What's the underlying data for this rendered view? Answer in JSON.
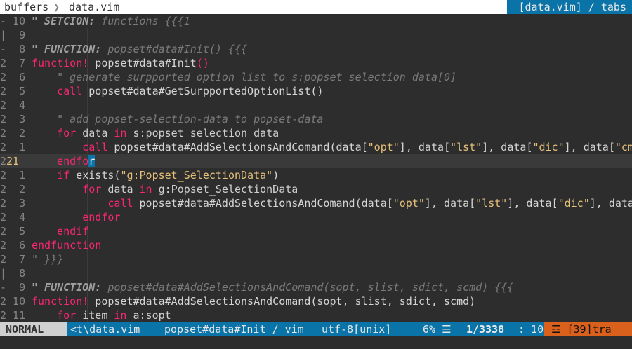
{
  "tabline": {
    "left_label": "buffers",
    "file_tab": "data.vim",
    "right_label": "[data.vim] / tabs"
  },
  "lines": [
    {
      "rel": "10",
      "abs_prefix": "-",
      "parts": [
        [
          "cmb",
          "\" SETCION:"
        ],
        [
          "cm",
          " functions {{{1"
        ]
      ]
    },
    {
      "rel": "9",
      "abs_prefix": "|",
      "parts": []
    },
    {
      "rel": "8",
      "abs_prefix": "-",
      "parts": [
        [
          "cmb",
          "\" FUNCTION:"
        ],
        [
          "cm",
          " popset#data#Init() {{{"
        ]
      ]
    },
    {
      "rel": "7",
      "abs_prefix": "2",
      "parts": [
        [
          "kw",
          "function!"
        ],
        [
          "fn",
          " popset#data#Init"
        ],
        [
          "kw",
          "()"
        ]
      ]
    },
    {
      "rel": "6",
      "abs_prefix": "2",
      "parts": [
        [
          "cm",
          "    \" generate surpported option list to s:popset_selection_data[0]"
        ]
      ]
    },
    {
      "rel": "5",
      "abs_prefix": "2",
      "parts": [
        [
          "kw",
          "    call"
        ],
        [
          "fn",
          " popset#data#GetSurpportedOptionList()"
        ]
      ]
    },
    {
      "rel": "4",
      "abs_prefix": "2",
      "parts": []
    },
    {
      "rel": "3",
      "abs_prefix": "2",
      "parts": [
        [
          "cm",
          "    \" add popset-selection-data to popset-data"
        ]
      ]
    },
    {
      "rel": "2",
      "abs_prefix": "2",
      "parts": [
        [
          "kw",
          "    for"
        ],
        [
          "var",
          " data"
        ],
        [
          "kw",
          " in"
        ],
        [
          "var",
          " s:popset_selection_data"
        ]
      ]
    },
    {
      "rel": "1",
      "abs_prefix": "2",
      "parts": [
        [
          "kw",
          "        call"
        ],
        [
          "fn",
          " popset#data#AddSelectionsAndComand(data["
        ],
        [
          "str",
          "\"opt\""
        ],
        [
          "fn",
          "], data["
        ],
        [
          "str",
          "\"lst\""
        ],
        [
          "fn",
          "], data["
        ],
        [
          "str",
          "\"dic\""
        ],
        [
          "fn",
          "], data["
        ],
        [
          "str",
          "\"cm"
        ]
      ]
    },
    {
      "rel": "21",
      "abs_prefix": "2",
      "current": true,
      "parts": [
        [
          "kw",
          "    endfo"
        ],
        [
          "cursor",
          "r"
        ]
      ]
    },
    {
      "rel": "1",
      "abs_prefix": "2",
      "parts": [
        [
          "kw",
          "    if"
        ],
        [
          "fn",
          " exists("
        ],
        [
          "str",
          "\"g:Popset_SelectionData\""
        ],
        [
          "fn",
          ")"
        ]
      ]
    },
    {
      "rel": "2",
      "abs_prefix": "2",
      "parts": [
        [
          "kw",
          "        for"
        ],
        [
          "var",
          " data"
        ],
        [
          "kw",
          " in"
        ],
        [
          "var",
          " g:Popset_SelectionData"
        ]
      ]
    },
    {
      "rel": "3",
      "abs_prefix": "2",
      "parts": [
        [
          "kw",
          "            call"
        ],
        [
          "fn",
          " popset#data#AddSelectionsAndComand(data["
        ],
        [
          "str",
          "\"opt\""
        ],
        [
          "fn",
          "], data["
        ],
        [
          "str",
          "\"lst\""
        ],
        [
          "fn",
          "], data["
        ],
        [
          "str",
          "\"dic\""
        ],
        [
          "fn",
          "], data"
        ]
      ]
    },
    {
      "rel": "4",
      "abs_prefix": "2",
      "parts": [
        [
          "kw",
          "        endfor"
        ]
      ]
    },
    {
      "rel": "5",
      "abs_prefix": "2",
      "parts": [
        [
          "kw",
          "    endif"
        ]
      ]
    },
    {
      "rel": "6",
      "abs_prefix": "2",
      "parts": [
        [
          "kw",
          "endfunction"
        ]
      ]
    },
    {
      "rel": "7",
      "abs_prefix": "2",
      "parts": [
        [
          "cm",
          "\" }}}"
        ]
      ]
    },
    {
      "rel": "8",
      "abs_prefix": "|",
      "parts": []
    },
    {
      "rel": "9",
      "abs_prefix": "-",
      "parts": [
        [
          "cmb",
          "\" FUNCTION:"
        ],
        [
          "cm",
          " popset#data#AddSelectionsAndComand(sopt, slist, sdict, scmd) {{{"
        ]
      ]
    },
    {
      "rel": "10",
      "abs_prefix": "2",
      "parts": [
        [
          "kw",
          "function!"
        ],
        [
          "fn",
          " popset#data#AddSelectionsAndComand(sopt, slist, sdict, scmd)"
        ]
      ]
    },
    {
      "rel": "11",
      "abs_prefix": "2",
      "parts": [
        [
          "kw",
          "    for"
        ],
        [
          "var",
          " item"
        ],
        [
          "kw",
          " in"
        ],
        [
          "var",
          " a:sopt"
        ]
      ]
    }
  ],
  "statusline": {
    "mode": "NORMAL",
    "file": "<t\\data.vim",
    "function": "popset#data#Init / vim",
    "encoding": "utf-8[unix]",
    "percent": "6% ☰",
    "position": "1/3338",
    "column": ": 10",
    "warning": "☲ [39]tra"
  },
  "colors": {
    "accent": "#0a73a8",
    "keyword": "#f92672",
    "string": "#e5c07b",
    "warning": "#d9611c"
  }
}
